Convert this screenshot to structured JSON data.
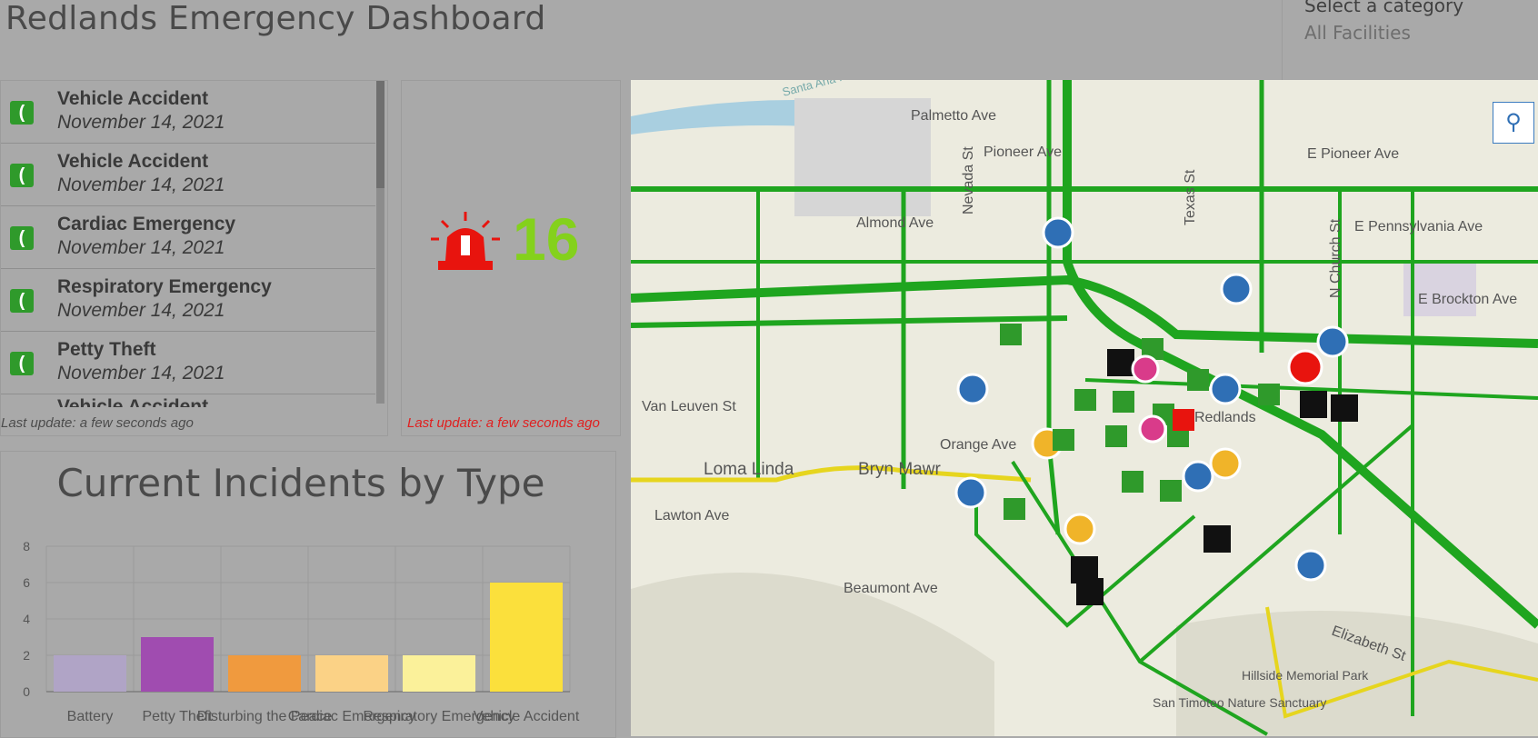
{
  "header": {
    "title": "Redlands Emergency Dashboard"
  },
  "category": {
    "label": "Select a category",
    "value": "All Facilities"
  },
  "incident_list": {
    "items": [
      {
        "type": "Vehicle Accident",
        "date": "November 14, 2021"
      },
      {
        "type": "Vehicle Accident",
        "date": "November 14, 2021"
      },
      {
        "type": "Cardiac Emergency",
        "date": "November 14, 2021"
      },
      {
        "type": "Respiratory Emergency",
        "date": "November 14, 2021"
      },
      {
        "type": "Petty Theft",
        "date": "November 14, 2021"
      },
      {
        "type": "Vehicle Accident",
        "date": ""
      }
    ],
    "footer": "Last update: a few seconds ago"
  },
  "counter": {
    "value": "16",
    "icon": "siren-icon",
    "footer": "Last update: a few seconds ago"
  },
  "chart_title": "Current Incidents by Type",
  "chart_data": {
    "type": "bar",
    "categories": [
      "Battery",
      "Petty Theft",
      "Disturbing the Peace",
      "Cardiac Emergency",
      "Respiratory Emergency",
      "Vehicle Accident"
    ],
    "values": [
      2,
      3,
      2,
      2,
      2,
      6
    ],
    "colors": [
      "#b0a4c6",
      "#a04cb0",
      "#f09a3e",
      "#fbd286",
      "#fbf19a",
      "#fbe03c"
    ],
    "ylim": [
      0,
      8
    ],
    "yticks": [
      0,
      2,
      4,
      6,
      8
    ],
    "title": "Current Incidents by Type",
    "xlabel": "",
    "ylabel": "",
    "grid": true
  },
  "map": {
    "labels": [
      "Palmetto Ave",
      "Pioneer Ave",
      "E Pioneer Ave",
      "Almond Ave",
      "E Pennsylvania Ave",
      "E Brockton Ave",
      "Van Leuven St",
      "Orange Ave",
      "Loma Linda",
      "Bryn Mawr",
      "Lawton Ave",
      "Beaumont Ave",
      "Elizabeth St",
      "Nevada St",
      "Texas St",
      "N Church St",
      "Redlands",
      "Hillside Memorial Park",
      "San Timoteo Nature Sanctuary",
      "Santa Ana River"
    ],
    "search_icon": "search-icon"
  }
}
